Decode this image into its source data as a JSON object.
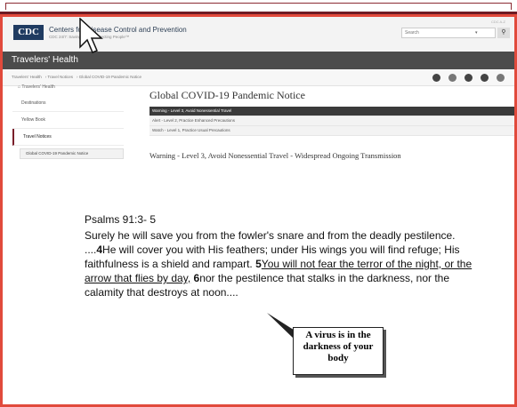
{
  "header": {
    "org_name": "Centers for Disease Control and Prevention",
    "org_tagline": "CDC 24/7: Saving Lives, Protecting People™",
    "logo_text": "CDC",
    "top_link": "CDC A-Z",
    "search_placeholder": "Search",
    "search_dropdown": "▾",
    "search_button_glyph": "⚲"
  },
  "site_bar": {
    "title": "Travelers' Health"
  },
  "breadcrumb": [
    "Travelers' Health",
    "Travel Notices",
    "Global COVID-19 Pandemic Notice"
  ],
  "sidebar": {
    "home": "Travelers' Health",
    "items": [
      "Destinations",
      "Yellow Book",
      "Travel Notices"
    ],
    "sub_item": "Global COVID-19 Pandemic Notice"
  },
  "main": {
    "title": "Global COVID-19 Pandemic Notice",
    "alerts": [
      "Warning - Level 3, Avoid Nonessential Travel",
      "Alert - Level 2, Practice Enhanced Precautions",
      "Watch - Level 1, Practice Usual Precautions"
    ],
    "warning_line": "Warning - Level 3, Avoid Nonessential Travel - Widespread Ongoing Transmission"
  },
  "overlay": {
    "reference": "Psalms 91:3- 5",
    "verse_lead": "Surely he will save you from the fowler's snare and from the deadly pestilence.",
    "ellipsis_1": "....",
    "num_4": "4",
    "verse_4": "He will cover you with His feathers; under His wings you will find refuge; His faithfulness is a shield and rampart.",
    "num_5": "5",
    "verse_5a": "You will not fear the terror of the night, or the arrow that flies by day,",
    "num_6": "6",
    "verse_6": "nor the pestilence that stalks in the darkness, nor the calamity that destroys at noon",
    "ellipsis_2": "....",
    "callout": "A virus is in the darkness of your body"
  },
  "colors": {
    "frame_border": "#e14a3c",
    "top_band": "#6e1a23",
    "site_bar": "#4c4c4c",
    "cdc_blue": "#1f3b61"
  },
  "icons": [
    "facebook-icon",
    "twitter-icon",
    "linkedin-icon",
    "email-icon",
    "print-icon"
  ]
}
